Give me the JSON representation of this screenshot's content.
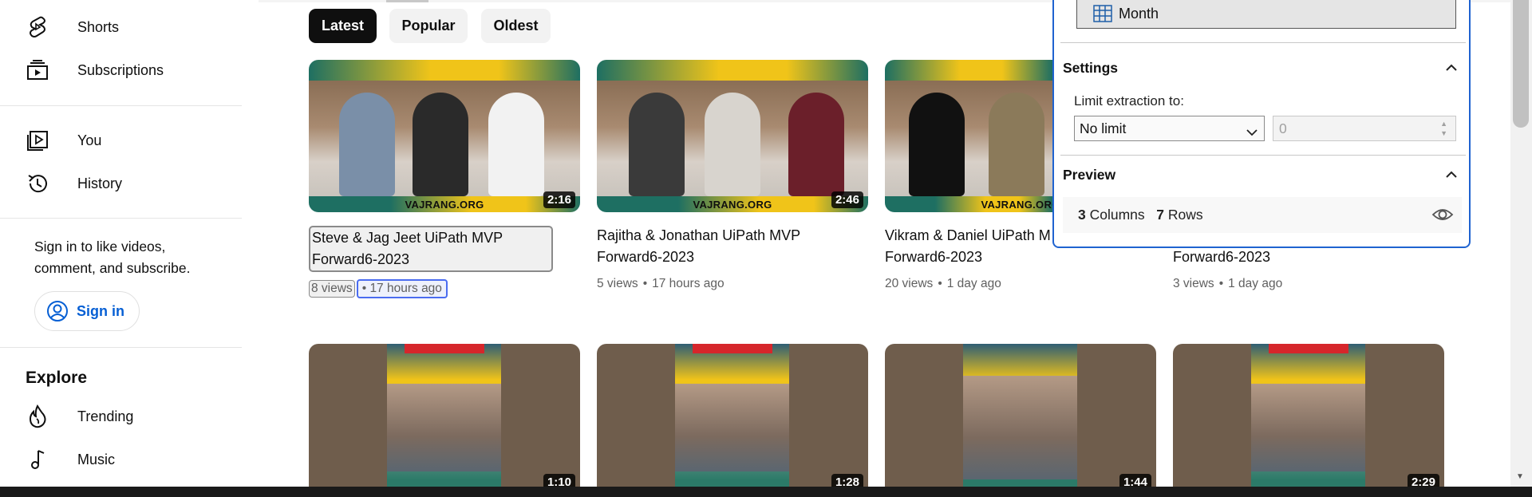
{
  "sidebar": {
    "items_top": [
      {
        "label": "Shorts",
        "icon": "shorts-icon"
      },
      {
        "label": "Subscriptions",
        "icon": "subscriptions-icon"
      }
    ],
    "items_you": [
      {
        "label": "You",
        "icon": "you-icon"
      },
      {
        "label": "History",
        "icon": "history-icon"
      }
    ],
    "signin_text": "Sign in to like videos, comment, and subscribe.",
    "signin_button": "Sign in",
    "explore_title": "Explore",
    "explore_items": [
      {
        "label": "Trending",
        "icon": "trending-icon"
      },
      {
        "label": "Music",
        "icon": "music-icon"
      }
    ]
  },
  "filters": {
    "chips": [
      "Latest",
      "Popular",
      "Oldest"
    ],
    "active": "Latest"
  },
  "videos_row1": [
    {
      "title": "Steve & Jag Jeet UiPath MVP Forward6-2023",
      "views": "8 views",
      "age": "17 hours ago",
      "duration": "2:16",
      "brand": "VAJRANG.ORG"
    },
    {
      "title": "Rajitha & Jonathan UiPath MVP Forward6-2023",
      "views": "5 views",
      "age": "17 hours ago",
      "duration": "2:46",
      "brand": "VAJRANG.ORG"
    },
    {
      "title": "Vikram & Daniel UiPath M",
      "title_line2": "Forward6-2023",
      "views": "20 views",
      "age": "1 day ago",
      "duration": "",
      "brand": "VAJRANG.ORG"
    },
    {
      "title": "Forward6-2023",
      "views": "3 views",
      "age": "1 day ago"
    }
  ],
  "videos_row2": [
    {
      "duration": "1:10"
    },
    {
      "duration": "1:28"
    },
    {
      "duration": "1:44"
    },
    {
      "duration": "2:29"
    }
  ],
  "meta_separator": "•",
  "panel": {
    "month_label": "Month",
    "settings_label": "Settings",
    "limit_label": "Limit extraction to:",
    "limit_value": "No limit",
    "limit_number": "0",
    "preview_label": "Preview",
    "columns_count": "3",
    "columns_label": "Columns",
    "rows_count": "7",
    "rows_label": "Rows"
  },
  "colors": {
    "accent_blue": "#065fd4",
    "panel_border": "#1f63d0",
    "chip_active": "#0f0f0f"
  }
}
